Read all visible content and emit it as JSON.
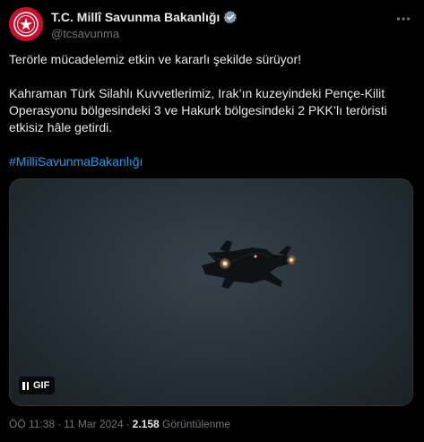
{
  "author": {
    "display_name": "T.C. Millî Savunma Bakanlığı",
    "handle": "@tcsavunma",
    "verified_icon": "verified-badge-icon",
    "avatar_color": "#c8102e"
  },
  "tweet": {
    "line1": "Terörle mücadelemiz etkin ve kararlı şekilde sürüyor!",
    "line2": "Kahraman Türk Silahlı Kuvvetlerimiz, Irak’ın kuzeyindeki Pençe-Kilit Operasyonu bölgesindeki 3 ve Hakurk bölgesindeki  2 PKK’lı teröristi etkisiz hâle getirdi.",
    "hashtag": "#MilliSavunmaBakanlığı"
  },
  "media": {
    "badge_label": "GIF",
    "pause_icon": "pause-icon"
  },
  "meta": {
    "time": "ÖÖ 11:38",
    "separator1": "·",
    "date": "11 Mar 2024",
    "separator2": "·",
    "views_count": "2.158",
    "views_label": "Görüntülenme"
  },
  "colors": {
    "background": "#000000",
    "text": "#e7e9ea",
    "secondary_text": "#71767b",
    "link": "#1d9bf0",
    "verified": "#829aab"
  }
}
